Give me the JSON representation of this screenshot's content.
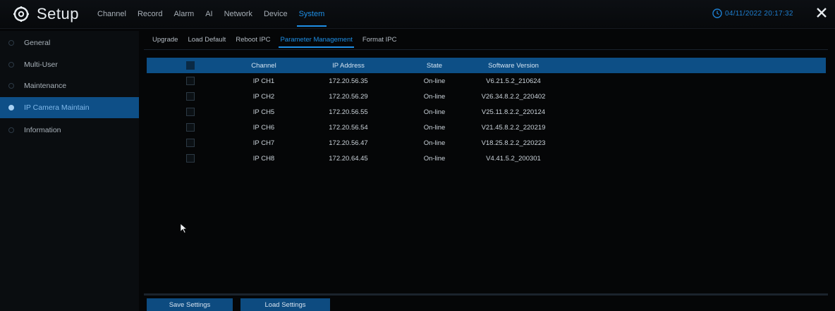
{
  "app": {
    "title": "Setup"
  },
  "top_menu": [
    {
      "label": "Channel"
    },
    {
      "label": "Record"
    },
    {
      "label": "Alarm"
    },
    {
      "label": "AI"
    },
    {
      "label": "Network"
    },
    {
      "label": "Device"
    },
    {
      "label": "System",
      "active": true
    }
  ],
  "datetime": "04/11/2022 20:17:32",
  "sidebar": {
    "items": [
      {
        "label": "General"
      },
      {
        "label": "Multi-User"
      },
      {
        "label": "Maintenance"
      },
      {
        "label": "IP Camera Maintain",
        "active": true
      },
      {
        "label": "Information"
      }
    ]
  },
  "subtabs": [
    {
      "label": "Upgrade"
    },
    {
      "label": "Load Default"
    },
    {
      "label": "Reboot IPC"
    },
    {
      "label": "Parameter Management",
      "active": true
    },
    {
      "label": "Format IPC"
    }
  ],
  "table": {
    "headers": {
      "channel": "Channel",
      "ip": "IP Address",
      "state": "State",
      "version": "Software Version"
    },
    "rows": [
      {
        "channel": "IP CH1",
        "ip": "172.20.56.35",
        "state": "On-line",
        "version": "V6.21.5.2_210624"
      },
      {
        "channel": "IP CH2",
        "ip": "172.20.56.29",
        "state": "On-line",
        "version": "V26.34.8.2.2_220402"
      },
      {
        "channel": "IP CH5",
        "ip": "172.20.56.55",
        "state": "On-line",
        "version": "V25.11.8.2.2_220124"
      },
      {
        "channel": "IP CH6",
        "ip": "172.20.56.54",
        "state": "On-line",
        "version": "V21.45.8.2.2_220219"
      },
      {
        "channel": "IP CH7",
        "ip": "172.20.56.47",
        "state": "On-line",
        "version": "V18.25.8.2.2_220223"
      },
      {
        "channel": "IP CH8",
        "ip": "172.20.64.45",
        "state": "On-line",
        "version": "V4.41.5.2_200301"
      }
    ]
  },
  "buttons": {
    "save": "Save Settings",
    "load": "Load Settings"
  },
  "colors": {
    "accent": "#1e8fe6",
    "header_bg": "#0d4f86",
    "active_side": "#0e4f87"
  },
  "icons": {
    "logo": "gear-icon",
    "clock": "clock-icon",
    "close": "close-icon",
    "pointer": "mouse-pointer-icon"
  }
}
